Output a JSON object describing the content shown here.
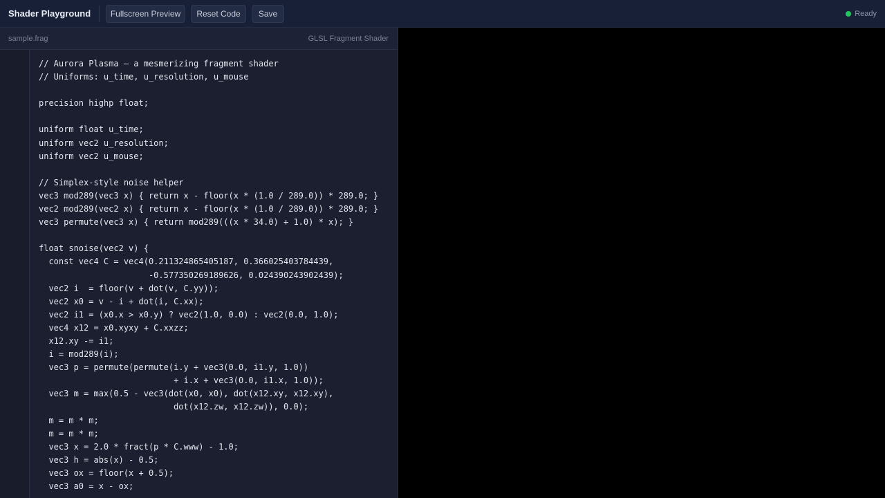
{
  "header": {
    "app_title": "Shader Playground",
    "buttons": {
      "fullscreen": "Fullscreen Preview",
      "reset": "Reset Code",
      "save": "Save"
    },
    "status": {
      "text": "Ready",
      "color": "#22c55e"
    }
  },
  "editor": {
    "file_name": "sample.frag",
    "language": "GLSL Fragment Shader",
    "code_lines": [
      "// Aurora Plasma — a mesmerizing fragment shader",
      "// Uniforms: u_time, u_resolution, u_mouse",
      "",
      "precision highp float;",
      "",
      "uniform float u_time;",
      "uniform vec2 u_resolution;",
      "uniform vec2 u_mouse;",
      "",
      "// Simplex-style noise helper",
      "vec3 mod289(vec3 x) { return x - floor(x * (1.0 / 289.0)) * 289.0; }",
      "vec2 mod289(vec2 x) { return x - floor(x * (1.0 / 289.0)) * 289.0; }",
      "vec3 permute(vec3 x) { return mod289(((x * 34.0) + 1.0) * x); }",
      "",
      "float snoise(vec2 v) {",
      "  const vec4 C = vec4(0.211324865405187, 0.366025403784439,",
      "                      -0.577350269189626, 0.024390243902439);",
      "  vec2 i  = floor(v + dot(v, C.yy));",
      "  vec2 x0 = v - i + dot(i, C.xx);",
      "  vec2 i1 = (x0.x > x0.y) ? vec2(1.0, 0.0) : vec2(0.0, 1.0);",
      "  vec4 x12 = x0.xyxy + C.xxzz;",
      "  x12.xy -= i1;",
      "  i = mod289(i);",
      "  vec3 p = permute(permute(i.y + vec3(0.0, i1.y, 1.0))",
      "                           + i.x + vec3(0.0, i1.x, 1.0));",
      "  vec3 m = max(0.5 - vec3(dot(x0, x0), dot(x12.xy, x12.xy),",
      "                           dot(x12.zw, x12.zw)), 0.0);",
      "  m = m * m;",
      "  m = m * m;",
      "  vec3 x = 2.0 * fract(p * C.www) - 1.0;",
      "  vec3 h = abs(x) - 0.5;",
      "  vec3 ox = floor(x + 0.5);",
      "  vec3 a0 = x - ox;"
    ]
  },
  "preview": {
    "background": "#000000"
  }
}
